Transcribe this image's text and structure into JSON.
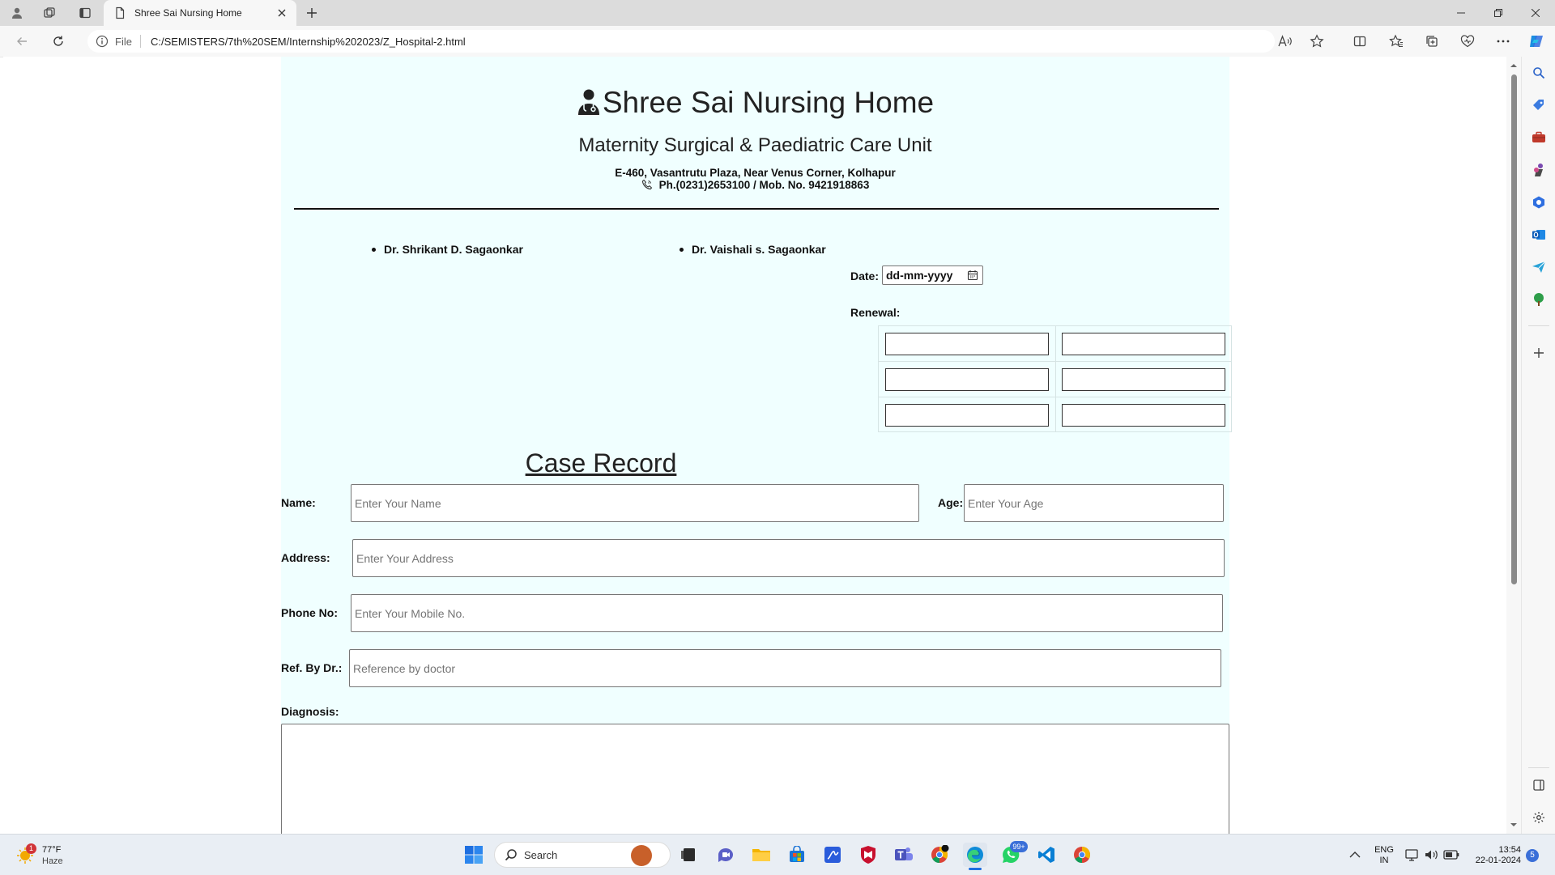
{
  "browser": {
    "tab_title": "Shree Sai Nursing Home",
    "address_scheme": "File",
    "address_url": "C:/SEMISTERS/7th%20SEM/Internship%202023/Z_Hospital-2.html"
  },
  "hospital": {
    "name": "Shree Sai Nursing Home",
    "subtitle": "Maternity Surgical & Paediatric Care Unit",
    "address": "E-460, Vasantrutu Plaza, Near Venus Corner, Kolhapur",
    "phone": "Ph.(0231)2653100 / Mob. No. 9421918863"
  },
  "doctors": [
    "Dr. Shrikant D. Sagaonkar",
    "Dr. Vaishali s. Sagaonkar"
  ],
  "date": {
    "label": "Date:",
    "placeholder": "dd-mm-yyyy"
  },
  "renewal": {
    "label": "Renewal:"
  },
  "case_record": {
    "title": "Case Record",
    "name": {
      "label": "Name:",
      "placeholder": "Enter Your Name"
    },
    "age": {
      "label": "Age:",
      "placeholder": "Enter Your Age"
    },
    "address": {
      "label": "Address:",
      "placeholder": "Enter Your Address"
    },
    "phone": {
      "label": "Phone No:",
      "placeholder": "Enter Your Mobile No."
    },
    "ref": {
      "label": "Ref. By Dr.:",
      "placeholder": "Reference by doctor"
    },
    "diagnosis": {
      "label": "Diagnosis:"
    }
  },
  "taskbar": {
    "weather_temp": "77°F",
    "weather_cond": "Haze",
    "weather_badge": "1",
    "search_label": "Search",
    "whatsapp_badge": "99+",
    "lang_line1": "ENG",
    "lang_line2": "IN",
    "time": "13:54",
    "date": "22-01-2024",
    "notif_count": "5"
  }
}
